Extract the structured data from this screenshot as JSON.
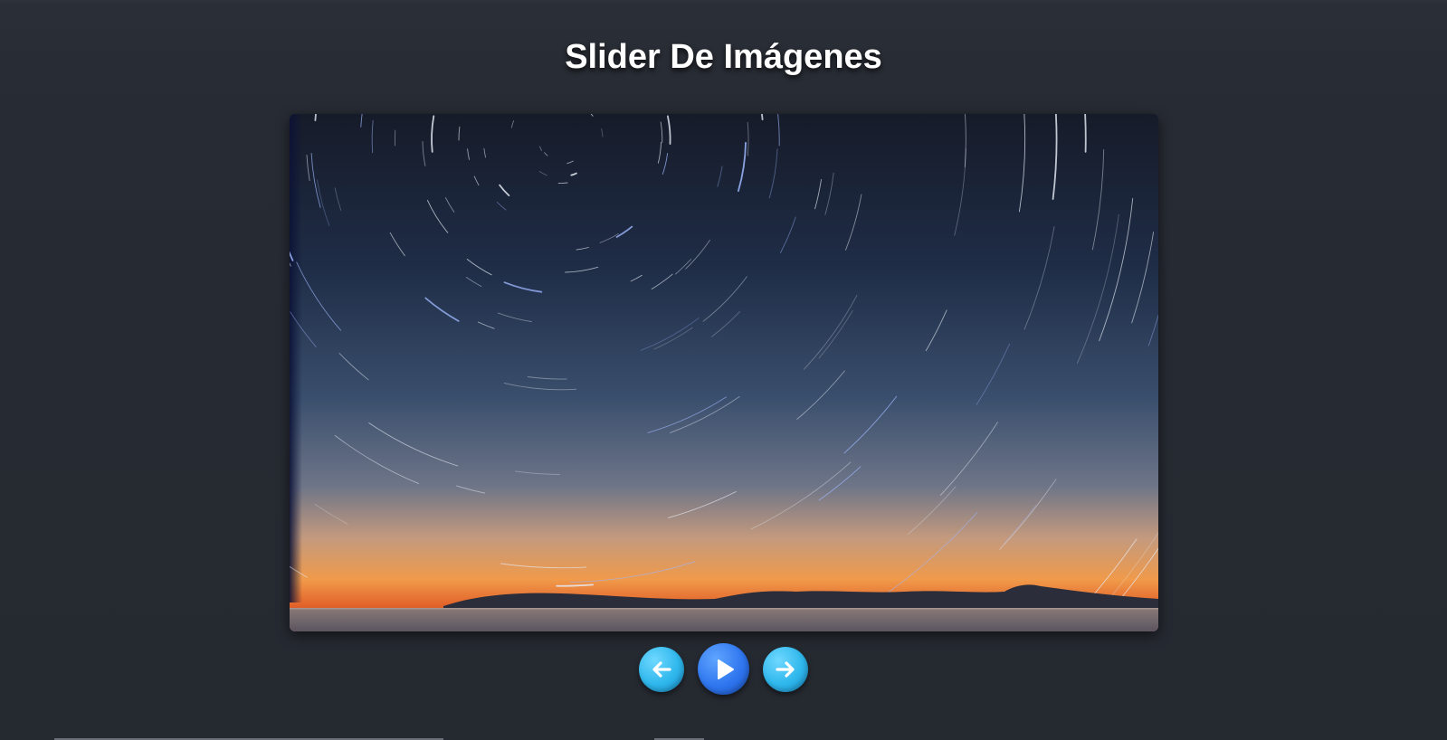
{
  "page": {
    "title": "Slider De Imágenes"
  },
  "slider": {
    "current_image": "star-trails-over-sea-at-sunset"
  },
  "controls": {
    "prev_icon": "arrow-left-icon",
    "play_icon": "play-icon",
    "next_icon": "arrow-right-icon"
  },
  "colors": {
    "background": "#282c34",
    "arrow_button": "#2fb7ec",
    "play_button": "#2f76ef"
  }
}
